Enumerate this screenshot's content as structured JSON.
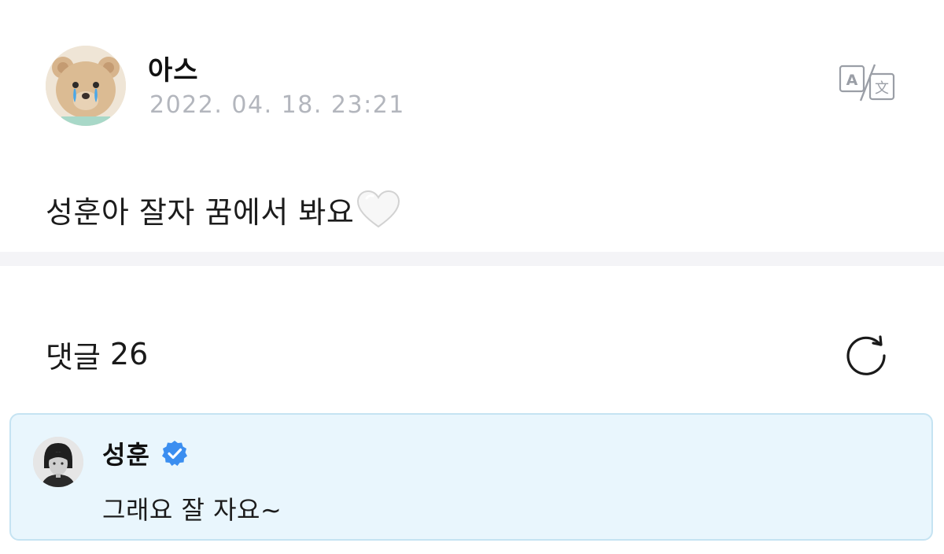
{
  "post": {
    "author_name": "아스",
    "timestamp": "2022. 04. 18. 23:21",
    "body_text": "성훈아 잘자 꿈에서 봐요",
    "emoji_icon": "white-heart-icon",
    "translate_icon": "translate-icon"
  },
  "comments": {
    "label": "댓글",
    "count": "26",
    "refresh_icon": "refresh-icon",
    "highlighted": {
      "author_name": "성훈",
      "verified_icon": "verified-badge-icon",
      "text": "그래요 잘 자요~"
    }
  },
  "colors": {
    "timestamp": "#b3b6bd",
    "comment_card_bg": "#e9f6fd",
    "comment_card_border": "#c5e3f2",
    "verified_badge": "#3b8ef0",
    "divider": "#f4f4f7"
  }
}
